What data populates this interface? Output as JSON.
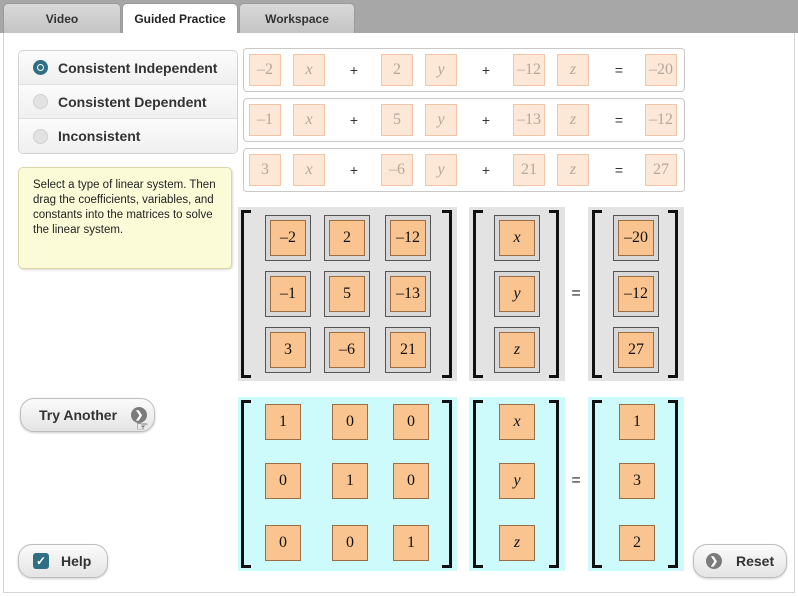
{
  "tabs": [
    {
      "label": "Video",
      "active": false
    },
    {
      "label": "Guided Practice",
      "active": true
    },
    {
      "label": "Workspace",
      "active": false
    }
  ],
  "system_types": {
    "selected": "Consistent Independent",
    "options": [
      "Consistent Independent",
      "Consistent Dependent",
      "Inconsistent"
    ]
  },
  "instructions": "Select a type of linear system. Then drag the coefficients, variables, and constants into the matrices to solve the linear system.",
  "equations": [
    {
      "a": "–2",
      "x": "x",
      "op1": "+",
      "b": "2",
      "y": "y",
      "op2": "+",
      "c": "–12",
      "z": "z",
      "eq": "=",
      "d": "–20"
    },
    {
      "a": "–1",
      "x": "x",
      "op1": "+",
      "b": "5",
      "y": "y",
      "op2": "+",
      "c": "–13",
      "z": "z",
      "eq": "=",
      "d": "–12"
    },
    {
      "a": "3",
      "x": "x",
      "op1": "+",
      "b": "–6",
      "y": "y",
      "op2": "+",
      "c": "21",
      "z": "z",
      "eq": "=",
      "d": "27"
    }
  ],
  "coefficient_matrix": [
    [
      "–2",
      "2",
      "–12"
    ],
    [
      "–1",
      "5",
      "–13"
    ],
    [
      "3",
      "–6",
      "21"
    ]
  ],
  "variable_vector": [
    "x",
    "y",
    "z"
  ],
  "constant_vector": [
    "–20",
    "–12",
    "27"
  ],
  "equals_sign": "=",
  "identity_matrix": [
    [
      "1",
      "0",
      "0"
    ],
    [
      "0",
      "1",
      "0"
    ],
    [
      "0",
      "0",
      "1"
    ]
  ],
  "solution_variables": [
    "x",
    "y",
    "z"
  ],
  "solution_values": [
    "1",
    "3",
    "2"
  ],
  "buttons": {
    "try_another": "Try Another",
    "help": "Help",
    "reset": "Reset"
  },
  "colors": {
    "accent": "#2f6f83",
    "tile_fill": "#f9c48f",
    "faded_tile_fill": "#fde7d6",
    "solution_panel": "#cdfbfb",
    "note_background": "#fcfbd8"
  },
  "icons": {
    "help_checkbox": "check-icon",
    "try_another": "arrow-circle-icon",
    "reset": "arrow-circle-icon",
    "cursor": "hand-pointer-icon"
  }
}
